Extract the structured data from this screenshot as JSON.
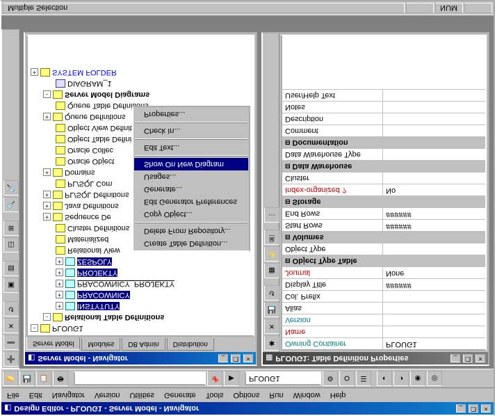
{
  "app": {
    "title": "Design Editor - PLOUG1 - Server Model - Navigator",
    "menus": [
      "File",
      "Edit",
      "Navigator",
      "Version",
      "Utilities",
      "Generate",
      "Tools",
      "Options",
      "Run",
      "Window",
      "Help"
    ],
    "toolbar_combo": "PLOUG1"
  },
  "navigator": {
    "title": "Server Model - Navigator",
    "tabs": [
      "Server Model",
      "Modules",
      "DB Admin",
      "Distribution"
    ],
    "tree": {
      "root": "PLOUG1",
      "rel_table_defs": "Relational Table Definitions",
      "t1": "INSTYTUTY",
      "t2": "PRACOWNICY",
      "t3": "PRACOWNICY_PROJEKTY",
      "t4": "PROJEKTY",
      "t5": "ZESPOLY",
      "rel_view": "Relational View",
      "materialized": "Materialized",
      "cluster_def": "Cluster Definitions",
      "sequence_de": "Sequence De",
      "java_def": "Java Definitions",
      "plsql_def": "PL/SQL Definitions",
      "plsql_com": "PL/SQL Com",
      "domains": "Domains",
      "oracle_obj": "Oracle Object",
      "oracle_coll": "Oracle Collec",
      "obj_table": "Object Table Definitions",
      "obj_view": "Object View Definitions",
      "queue_def": "Queue Definitions",
      "queue_table": "Queue Table Definitions",
      "server_model_diag": "Server Model Diagrams",
      "diagram1": "DIAGRAM_1",
      "system_folder": "SYSTEM FOLDER"
    }
  },
  "context_menu": {
    "items": [
      "Create Table Definition...",
      "Delete From Repository...",
      "Copy Object...",
      "Edit Generator Preferences",
      "Generate...",
      "Usages...",
      "Show On New Diagram",
      "Edit Text...",
      "Check In...",
      "Properties..."
    ],
    "highlight_index": 6
  },
  "properties": {
    "title": "PLOUG1: Table Definition Properties",
    "rows": [
      {
        "label": "Owning Container",
        "value": "PLOUG1",
        "class": "teal"
      },
      {
        "label": "Name",
        "value": "",
        "class": "red"
      },
      {
        "label": "Version",
        "value": "",
        "class": "teal"
      },
      {
        "label": "Alias",
        "value": ""
      },
      {
        "label": "Col. Prefix",
        "value": ""
      },
      {
        "label": "Display Title",
        "value": "######"
      },
      {
        "label": "Journal",
        "value": "None",
        "class": "red"
      },
      {
        "label": "Object Type Table",
        "value": "",
        "group": true
      },
      {
        "label": "Object Type",
        "value": ""
      },
      {
        "label": "Volumes",
        "value": "",
        "group": true
      },
      {
        "label": "Start Rows",
        "value": "######"
      },
      {
        "label": "End Rows",
        "value": "######"
      },
      {
        "label": "Storage",
        "value": "",
        "group": true
      },
      {
        "label": "Index-organized ?",
        "value": "No",
        "class": "red"
      },
      {
        "label": "Cluster",
        "value": ""
      },
      {
        "label": "Data Warehouse",
        "value": "",
        "group": true
      },
      {
        "label": "Data Warehouse Type",
        "value": ""
      },
      {
        "label": "Documentation",
        "value": "",
        "group": true
      },
      {
        "label": "Comment",
        "value": ""
      },
      {
        "label": "Description",
        "value": ""
      },
      {
        "label": "Notes",
        "value": ""
      },
      {
        "label": "User/Help Text",
        "value": ""
      }
    ]
  },
  "statusbar": {
    "text": "Multiple Selection",
    "num": "NUM"
  }
}
